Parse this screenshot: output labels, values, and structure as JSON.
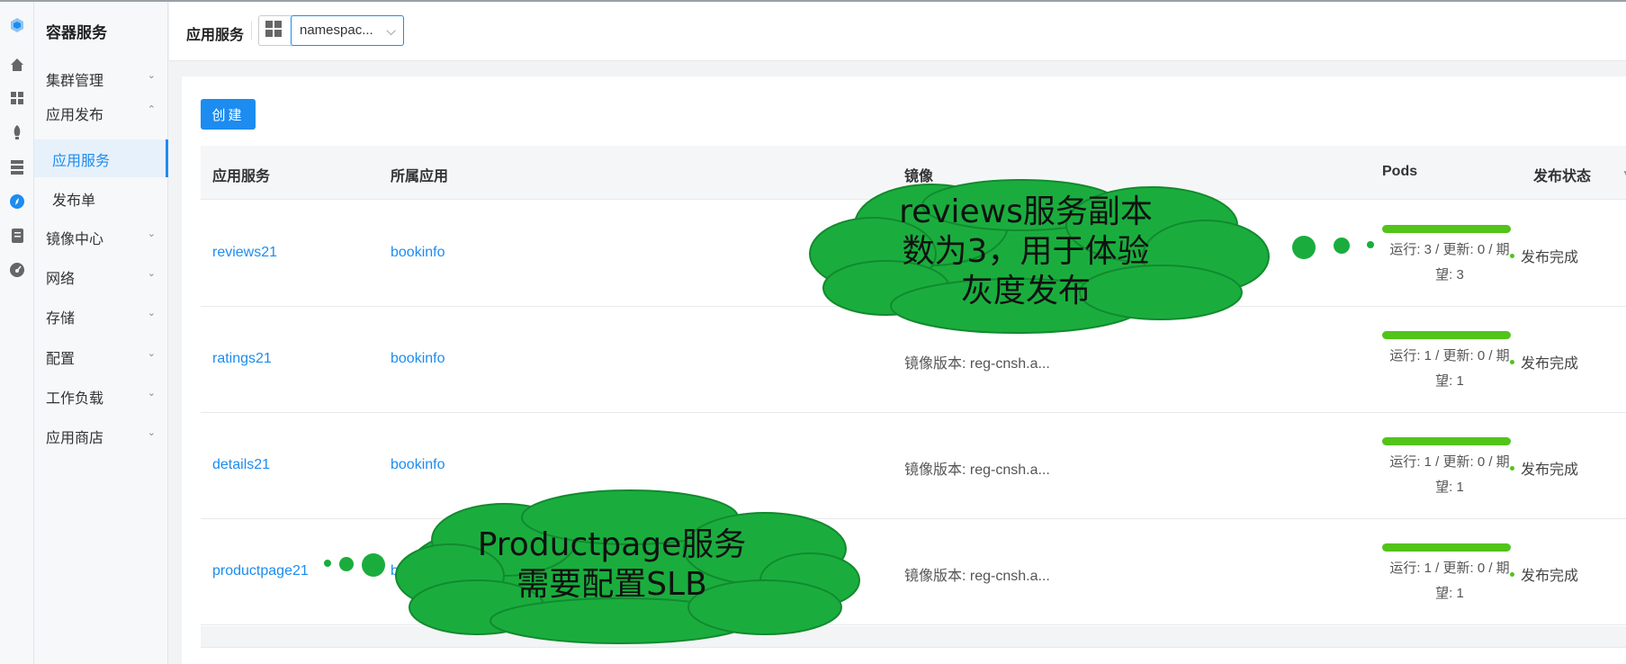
{
  "sidebar": {
    "title": "容器服务",
    "items": [
      {
        "label": "集群管理",
        "chevron": "⌄"
      },
      {
        "label": "应用发布",
        "chevron": "⌃"
      },
      {
        "label": "应用服务"
      },
      {
        "label": "发布单"
      },
      {
        "label": "镜像中心",
        "chevron": "⌄"
      },
      {
        "label": "网络",
        "chevron": "⌄"
      },
      {
        "label": "存储",
        "chevron": "⌄"
      },
      {
        "label": "配置",
        "chevron": "⌄"
      },
      {
        "label": "工作负载",
        "chevron": "⌄"
      },
      {
        "label": "应用商店",
        "chevron": "⌄"
      }
    ]
  },
  "header": {
    "title": "应用服务",
    "namespace": "namespac...",
    "namespace_arrow": "⌵"
  },
  "toolbar": {
    "create_label": "创建"
  },
  "table": {
    "columns": [
      "应用服务",
      "所属应用",
      "镜像",
      "Pods",
      "发布状态"
    ],
    "rows": [
      {
        "service": "reviews21",
        "app": "bookinfo",
        "image": "",
        "pods_line1": "运行: 3 / 更新: 0 / 期",
        "pods_line2": "望: 3",
        "running_fraction": 1.0,
        "status": "发布完成"
      },
      {
        "service": "ratings21",
        "app": "bookinfo",
        "image": "镜像版本: reg-cnsh.a...",
        "pods_line1": "运行: 1 / 更新: 0 / 期",
        "pods_line2": "望: 1",
        "running_fraction": 1.0,
        "status": "发布完成"
      },
      {
        "service": "details21",
        "app": "bookinfo",
        "image": "镜像版本: reg-cnsh.a...",
        "pods_line1": "运行: 1 / 更新: 0 / 期",
        "pods_line2": "望: 1",
        "running_fraction": 1.0,
        "status": "发布完成"
      },
      {
        "service": "productpage21",
        "app": "bookinfo",
        "image": "镜像版本: reg-cnsh.a...",
        "pods_line1": "运行: 1 / 更新: 0 / 期",
        "pods_line2": "望: 1",
        "running_fraction": 1.0,
        "status": "发布完成"
      }
    ]
  },
  "annotations": {
    "reviews_line1": "reviews服务副本",
    "reviews_line2": "数为3，用于体验",
    "reviews_line3": "灰度发布",
    "productpage_line1": "Productpage服务",
    "productpage_line2": "需要配置SLB"
  },
  "colors": {
    "accent": "#1c8cf0",
    "status_green": "#52c41a",
    "cloud_green": "#1aad3e"
  }
}
